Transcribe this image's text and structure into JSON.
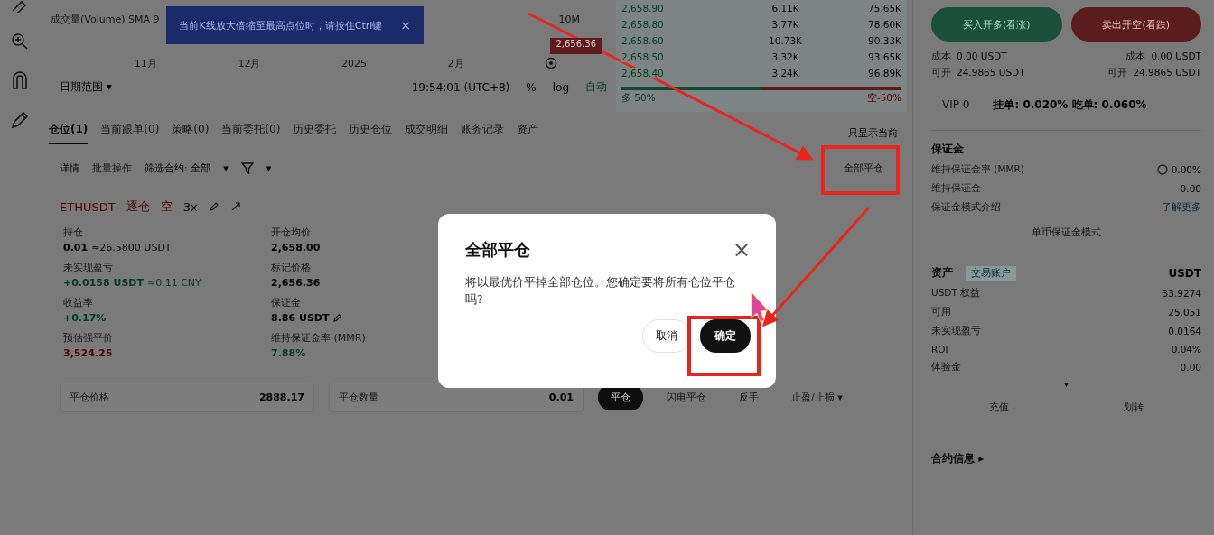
{
  "chart": {
    "legend": "成交量(Volume) SMA 9",
    "toast": {
      "text": "当前K线放大倍缩至最高点位时，请按住Ctrl键",
      "close": "×"
    },
    "axis_right": "10M",
    "price_badge": "2,656.36",
    "x_labels": [
      "11月",
      "12月",
      "2025",
      "2月"
    ],
    "toolbar": {
      "date_range": "日期范围 ▾",
      "time": "19:54:01 (UTC+8)",
      "percent": "%",
      "log": "log",
      "auto": "自动"
    }
  },
  "order_book": {
    "rows": [
      {
        "price": "2,658.90",
        "amount": "6.11K",
        "total": "75.65K"
      },
      {
        "price": "2,658.80",
        "amount": "3.77K",
        "total": "78.60K"
      },
      {
        "price": "2,658.60",
        "amount": "10.73K",
        "total": "90.33K"
      },
      {
        "price": "2,658.50",
        "amount": "3.32K",
        "total": "93.65K"
      },
      {
        "price": "2,658.40",
        "amount": "3.24K",
        "total": "96.89K"
      }
    ],
    "ratio": {
      "level": 0.5,
      "buy_label": "多 50%",
      "sell_label": "空-50%"
    }
  },
  "tabs": [
    {
      "label": "仓位(1)",
      "selected": true
    },
    {
      "label": "当前跟单(0)",
      "selected": false
    },
    {
      "label": "策略(0)",
      "selected": false
    },
    {
      "label": "当前委托(0)",
      "selected": false
    },
    {
      "label": "历史委托",
      "selected": false
    },
    {
      "label": "历史仓位",
      "selected": false
    },
    {
      "label": "成交明细",
      "selected": false
    },
    {
      "label": "账务记录",
      "selected": false
    },
    {
      "label": "资产",
      "selected": false
    }
  ],
  "show_current": "只显示当前",
  "filters": {
    "details": "详情",
    "batch": "批量操作",
    "contract_label": "筛选合约: 全部",
    "caret": "▾"
  },
  "close_all": "全部平仓",
  "position": {
    "symbol": "ETHUSDT",
    "margin_mode": "逐仓",
    "side": "空",
    "leverage": "3x",
    "fields": [
      {
        "label": "持仓",
        "value": "0.01",
        "note": "≈26.5800 USDT",
        "color": "#000000"
      },
      {
        "label": "开仓均价",
        "value": "2,658.00",
        "color": "#000000"
      },
      {
        "label": "未实现盈亏",
        "value": "+0.0158 USDT",
        "note": "≈0.11 CNY",
        "color": "#003d26"
      },
      {
        "label": "标记价格",
        "value": "2,656.36",
        "color": "#000000"
      },
      {
        "label": "收益率",
        "value": "+0.17%",
        "color": "#003d26"
      },
      {
        "label": "保证金",
        "value": "8.86 USDT",
        "color": "#000000",
        "editable": true
      },
      {
        "label": "预估强平价",
        "value": "3,524.25",
        "color": "#4d0000"
      },
      {
        "label": "维持保证金率 (MMR)",
        "value": "7.88%",
        "color": "#003d26"
      }
    ]
  },
  "close_bar": {
    "price_label": "平仓价格",
    "price": "2888.17",
    "qty_label": "平仓数量",
    "qty": "0.01",
    "close_button": "平仓",
    "flash_close": "闪电平仓",
    "reverse": "反手",
    "tpsl": "止盈/止损 ▾"
  },
  "dialog": {
    "title": "全部平仓",
    "close": "×",
    "message": "将以最优价平掉全部仓位。您确定要将所有仓位平仓吗?",
    "cancel": "取消",
    "confirm": "确定"
  },
  "trade": {
    "buy": "买入开多(看涨)",
    "sell": "卖出开空(看跌)",
    "info": [
      {
        "label": "成本",
        "value": "0.00 USDT"
      },
      {
        "label": "成本",
        "value": "0.00 USDT"
      },
      {
        "label": "可开",
        "value": "24.9865 USDT"
      },
      {
        "label": "可开",
        "value": "24.9865 USDT"
      }
    ],
    "vip": "VIP 0",
    "fees": "挂单: 0.020%  吃单: 0.060%"
  },
  "margin": {
    "title": "保证金",
    "rows": [
      {
        "label": "维持保证金率 (MMR)",
        "value": "0.00%",
        "kind": "gauge"
      },
      {
        "label": "维持保证金",
        "value": "0.00",
        "kind": "plain"
      },
      {
        "label": "保证金模式介绍",
        "value": "了解更多",
        "kind": "link"
      }
    ],
    "mode_button": "单币保证金模式"
  },
  "assets": {
    "title": "资产",
    "tag": "交易账户",
    "currency": "USDT",
    "rows": [
      {
        "label": "USDT 权益",
        "value": "33.9274"
      },
      {
        "label": "可用",
        "value": "25.051"
      },
      {
        "label": "未实现盈亏",
        "value": "0.0164"
      },
      {
        "label": "ROI",
        "value": "0.04%"
      },
      {
        "label": "体验金",
        "value": "0.00"
      }
    ],
    "expand": "▾",
    "deposit": "充值",
    "transfer": "划转"
  },
  "contract_info": "合约信息 ▸"
}
